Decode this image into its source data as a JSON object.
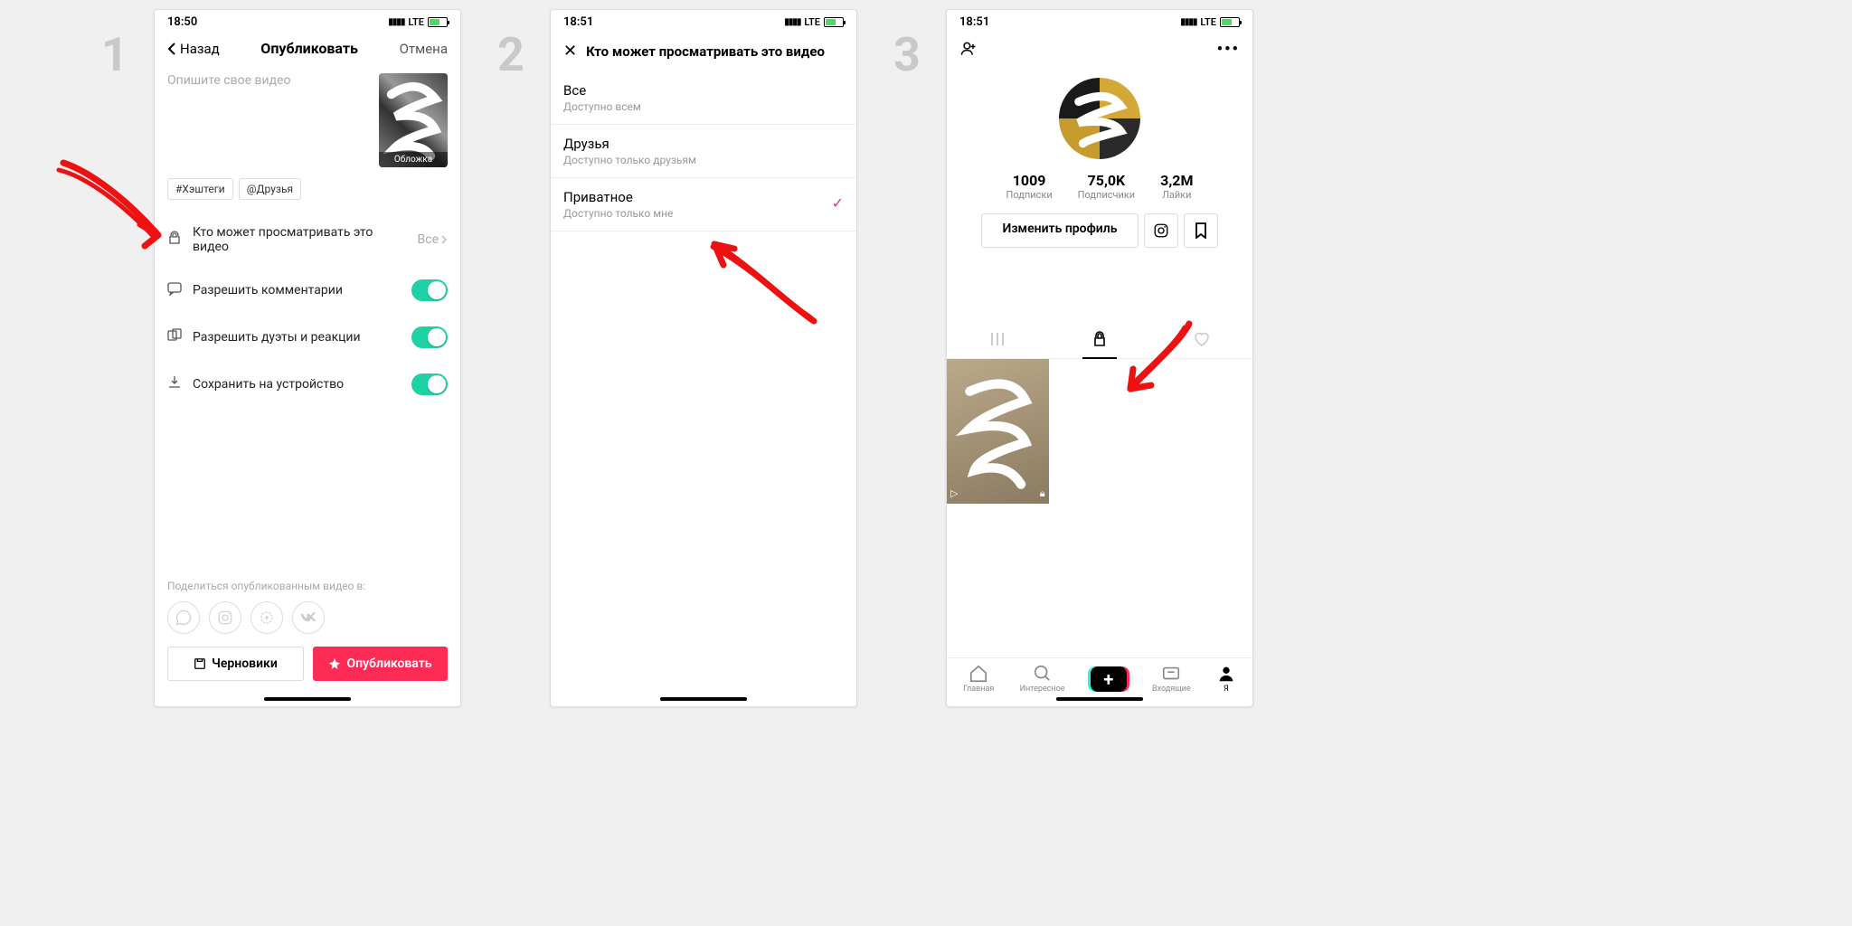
{
  "status": {
    "time1": "18:50",
    "time2": "18:51",
    "time3": "18:51",
    "net": "LTE"
  },
  "screen1": {
    "back": "Назад",
    "title": "Опубликовать",
    "cancel": "Отмена",
    "placeholder": "Опишите свое видео",
    "thumb_label": "Обложка",
    "pill_hashtags": "#Хэштеги",
    "pill_friends": "@Друзья",
    "privacy_label": "Кто может просматривать это видео",
    "privacy_value": "Все",
    "comments_label": "Разрешить комментарии",
    "duets_label": "Разрешить дуэты и реакции",
    "save_label": "Сохранить на устройство",
    "share_label": "Поделиться опубликованным видео в:",
    "drafts": "Черновики",
    "publish": "Опубликовать"
  },
  "screen2": {
    "title": "Кто может просматривать это видео",
    "opt1": {
      "t": "Все",
      "s": "Доступно всем"
    },
    "opt2": {
      "t": "Друзья",
      "s": "Доступно только друзьям"
    },
    "opt3": {
      "t": "Приватное",
      "s": "Доступно только мне"
    }
  },
  "screen3": {
    "stats": {
      "following_val": "1009",
      "following_lbl": "Подписки",
      "followers_val": "75,0K",
      "followers_lbl": "Подписчики",
      "likes_val": "3,2M",
      "likes_lbl": "Лайки"
    },
    "edit": "Изменить профиль",
    "bnav": {
      "home": "Главная",
      "discover": "Интересное",
      "inbox": "Входящие",
      "me": "Я"
    }
  },
  "steps": {
    "s1": "1",
    "s2": "2",
    "s3": "3"
  }
}
